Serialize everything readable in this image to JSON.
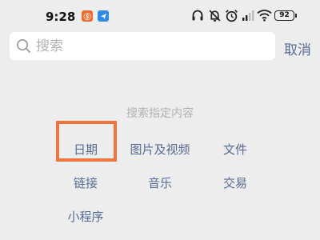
{
  "status_bar": {
    "time": "9:28",
    "app_badge_1": "Ⓢ",
    "battery": "92",
    "icons": [
      "headphones-icon",
      "mute-icon",
      "alarm-icon",
      "signal-icon",
      "wifi-icon",
      "battery-icon"
    ]
  },
  "search": {
    "placeholder": "搜索",
    "value": "",
    "cancel_label": "取消"
  },
  "categories": {
    "title": "搜索指定内容",
    "items": [
      {
        "label": "日期",
        "highlighted": true
      },
      {
        "label": "图片及视频"
      },
      {
        "label": "文件"
      },
      {
        "label": "链接"
      },
      {
        "label": "音乐"
      },
      {
        "label": "交易"
      },
      {
        "label": "小程序"
      }
    ]
  },
  "colors": {
    "background": "#ededed",
    "link": "#576b95",
    "highlight": "#f0743e",
    "muted": "#b2b2b2"
  }
}
